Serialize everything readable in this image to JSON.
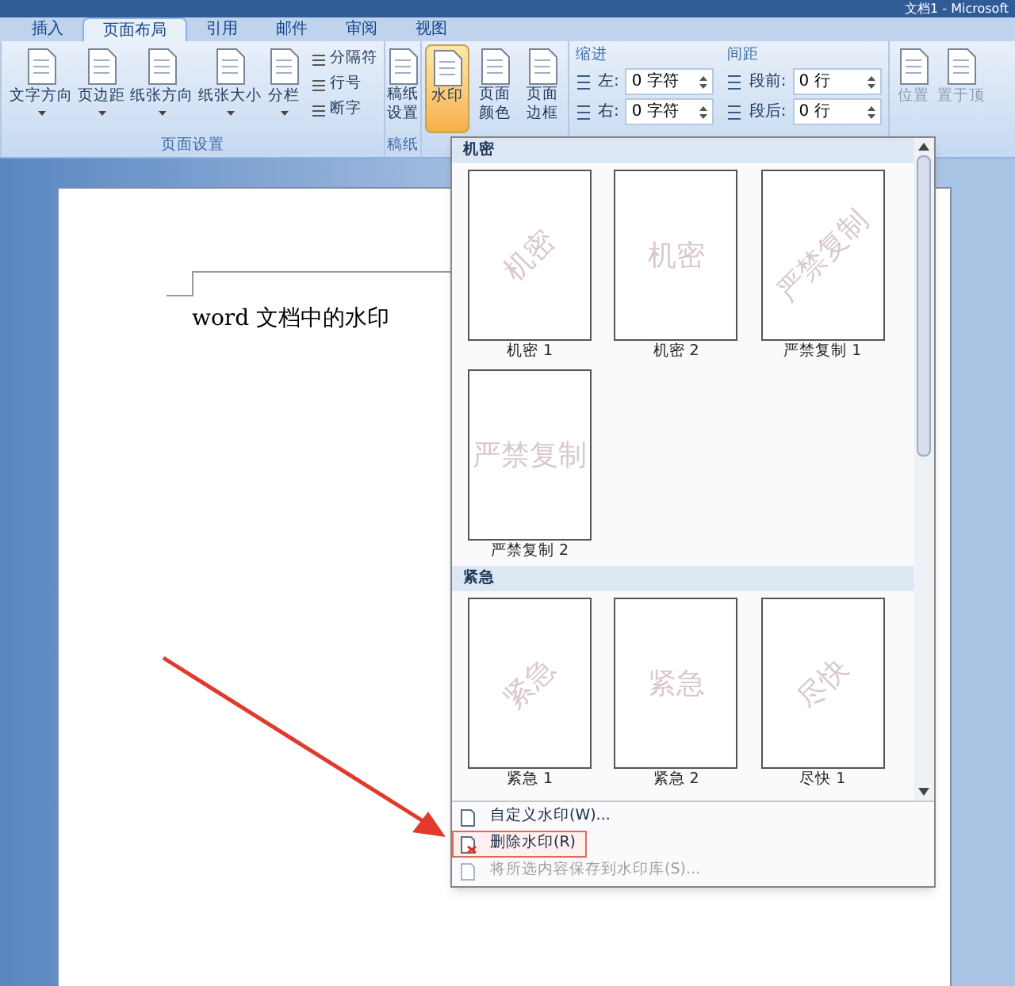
{
  "window": {
    "title": "文档1 - Microsoft"
  },
  "tabs": [
    {
      "label": "插入",
      "selected": false
    },
    {
      "label": "页面布局",
      "selected": true
    },
    {
      "label": "引用",
      "selected": false
    },
    {
      "label": "邮件",
      "selected": false
    },
    {
      "label": "审阅",
      "selected": false
    },
    {
      "label": "视图",
      "selected": false
    }
  ],
  "ribbon": {
    "page_setup": {
      "label": "页面设置",
      "buttons": [
        {
          "label": "文字方向"
        },
        {
          "label": "页边距"
        },
        {
          "label": "纸张方向"
        },
        {
          "label": "纸张大小"
        },
        {
          "label": "分栏"
        }
      ],
      "small_buttons": [
        "分隔符",
        "行号",
        "断字"
      ]
    },
    "draft": {
      "label": "稿纸",
      "button": "稿纸设置"
    },
    "background": {
      "buttons": [
        {
          "label": "水印",
          "selected": true
        },
        {
          "label": "页面颜色",
          "selected": false
        },
        {
          "label": "页面边框",
          "selected": false
        }
      ]
    },
    "paragraph": {
      "indent": {
        "title": "缩进",
        "fields": [
          {
            "label": "左:",
            "value": "0 字符"
          },
          {
            "label": "右:",
            "value": "0 字符"
          }
        ]
      },
      "spacing": {
        "title": "间距",
        "fields": [
          {
            "label": "段前:",
            "value": "0 行"
          },
          {
            "label": "段后:",
            "value": "0 行"
          }
        ]
      }
    },
    "arrange": {
      "buttons": [
        {
          "label": "位置"
        },
        {
          "label": "置于顶"
        }
      ]
    }
  },
  "document": {
    "text": "word 文档中的水印"
  },
  "watermark_menu": {
    "sections": [
      {
        "title": "机密",
        "items": [
          {
            "name": "机密 1",
            "preview": "机密",
            "kind": "diagonal"
          },
          {
            "name": "机密 2",
            "preview": "机密",
            "kind": "horizontal"
          },
          {
            "name": "严禁复制 1",
            "preview": "严禁复制",
            "kind": "diagonal"
          },
          {
            "name": "严禁复制 2",
            "preview": "严禁复制",
            "kind": "horizontal"
          }
        ]
      },
      {
        "title": "紧急",
        "items": [
          {
            "name": "紧急 1",
            "preview": "紧急",
            "kind": "diagonal"
          },
          {
            "name": "紧急 2",
            "preview": "紧急",
            "kind": "horizontal"
          },
          {
            "name": "尽快 1",
            "preview": "尽快",
            "kind": "diagonal"
          }
        ]
      }
    ],
    "commands": [
      {
        "label": "自定义水印(W)...",
        "highlighted": false,
        "disabled": false
      },
      {
        "label": "删除水印(R)",
        "highlighted": true,
        "disabled": false
      },
      {
        "label": "将所选内容保存到水印库(S)...",
        "highlighted": false,
        "disabled": true
      }
    ]
  }
}
